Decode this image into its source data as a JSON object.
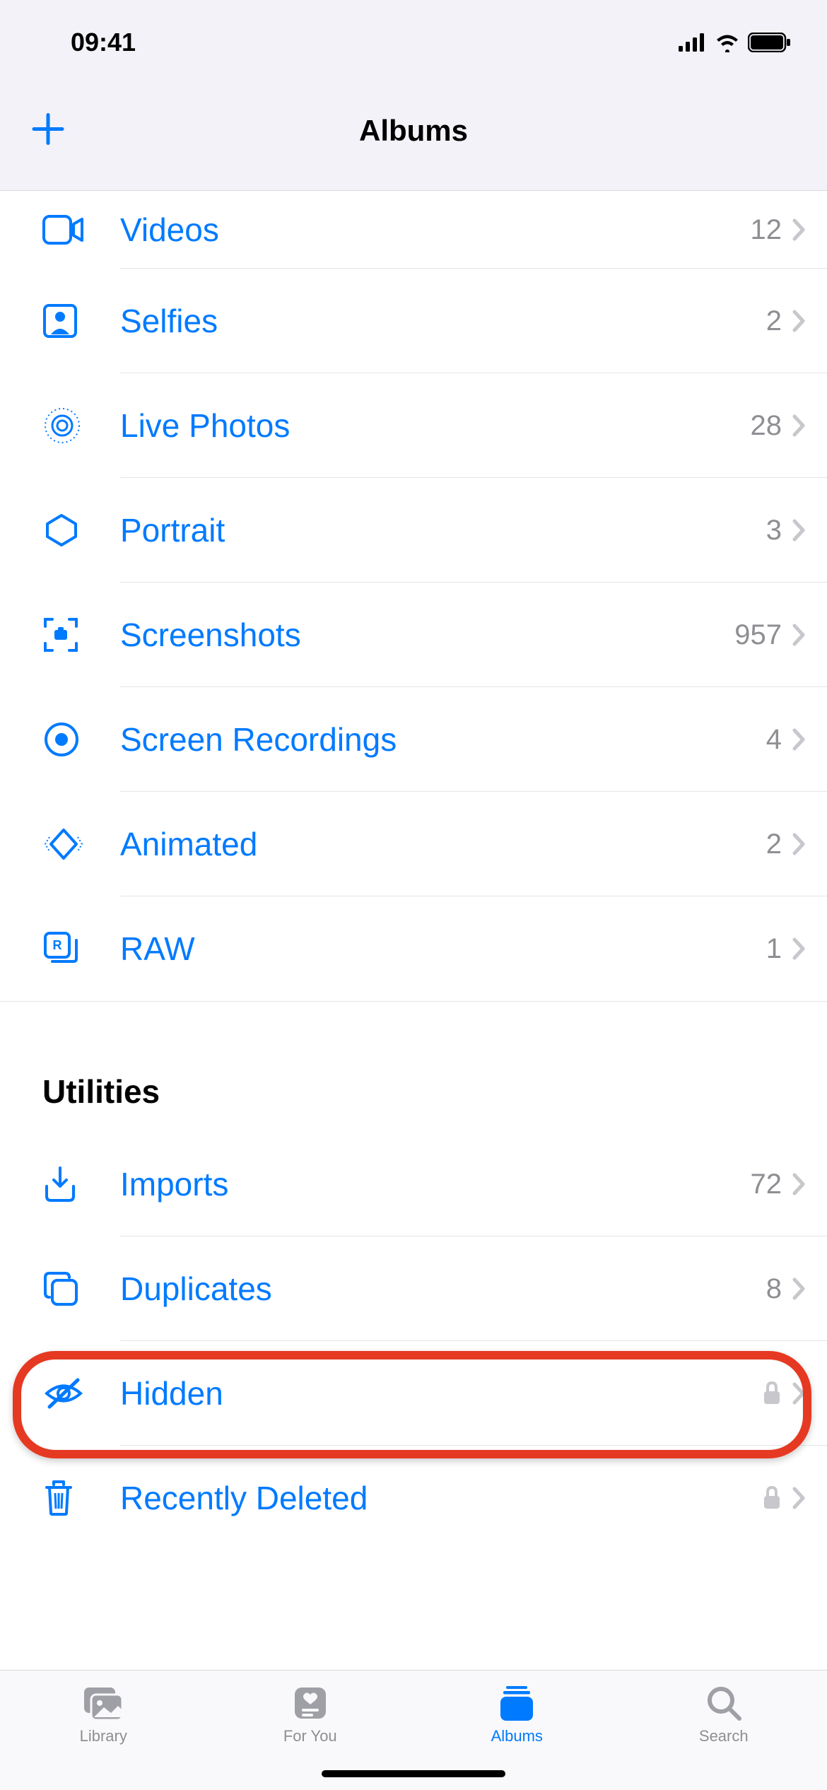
{
  "status": {
    "time": "09:41"
  },
  "nav": {
    "title": "Albums"
  },
  "media_types": [
    {
      "id": "videos",
      "label": "Videos",
      "count": "12",
      "locked": false
    },
    {
      "id": "selfies",
      "label": "Selfies",
      "count": "2",
      "locked": false
    },
    {
      "id": "live-photos",
      "label": "Live Photos",
      "count": "28",
      "locked": false
    },
    {
      "id": "portrait",
      "label": "Portrait",
      "count": "3",
      "locked": false
    },
    {
      "id": "screenshots",
      "label": "Screenshots",
      "count": "957",
      "locked": false
    },
    {
      "id": "screen-recordings",
      "label": "Screen Recordings",
      "count": "4",
      "locked": false
    },
    {
      "id": "animated",
      "label": "Animated",
      "count": "2",
      "locked": false
    },
    {
      "id": "raw",
      "label": "RAW",
      "count": "1",
      "locked": false
    }
  ],
  "utilities_header": "Utilities",
  "utilities": [
    {
      "id": "imports",
      "label": "Imports",
      "count": "72",
      "locked": false
    },
    {
      "id": "duplicates",
      "label": "Duplicates",
      "count": "8",
      "locked": false
    },
    {
      "id": "hidden",
      "label": "Hidden",
      "count": "",
      "locked": true,
      "highlighted": true
    },
    {
      "id": "recently-deleted",
      "label": "Recently Deleted",
      "count": "",
      "locked": true
    }
  ],
  "tabs": {
    "library": "Library",
    "for_you": "For You",
    "albums": "Albums",
    "search": "Search",
    "active": "albums"
  }
}
